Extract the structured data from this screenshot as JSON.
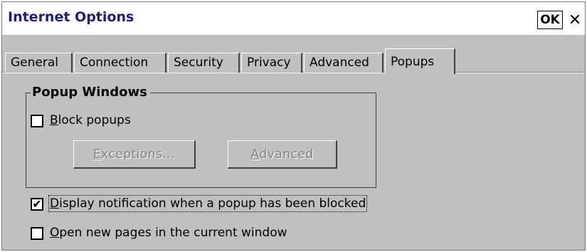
{
  "window": {
    "title": "Internet Options",
    "ok_label": "OK",
    "close_glyph": "✕"
  },
  "tabs": [
    {
      "label": "General",
      "active": false
    },
    {
      "label": "Connection",
      "active": false
    },
    {
      "label": "Security",
      "active": false
    },
    {
      "label": "Privacy",
      "active": false
    },
    {
      "label": "Advanced",
      "active": false
    },
    {
      "label": "Popups",
      "active": true
    }
  ],
  "popup_windows": {
    "group_title": "Popup Windows",
    "block_popups": {
      "checked": false,
      "mnemonic": "B",
      "label_rest": "lock popups"
    },
    "exceptions_button": {
      "mnemonic": "E",
      "label_rest": "xceptions..."
    },
    "advanced_button": {
      "mnemonic": "A",
      "label_rest": "dvanced"
    }
  },
  "options": {
    "display_notification": {
      "checked": true,
      "check_glyph": "✔",
      "mnemonic": "D",
      "label_rest": "isplay notification when a popup has been blocked"
    },
    "open_new_pages": {
      "checked": false,
      "mnemonic": "O",
      "label_rest": "pen new pages in the current window"
    }
  }
}
